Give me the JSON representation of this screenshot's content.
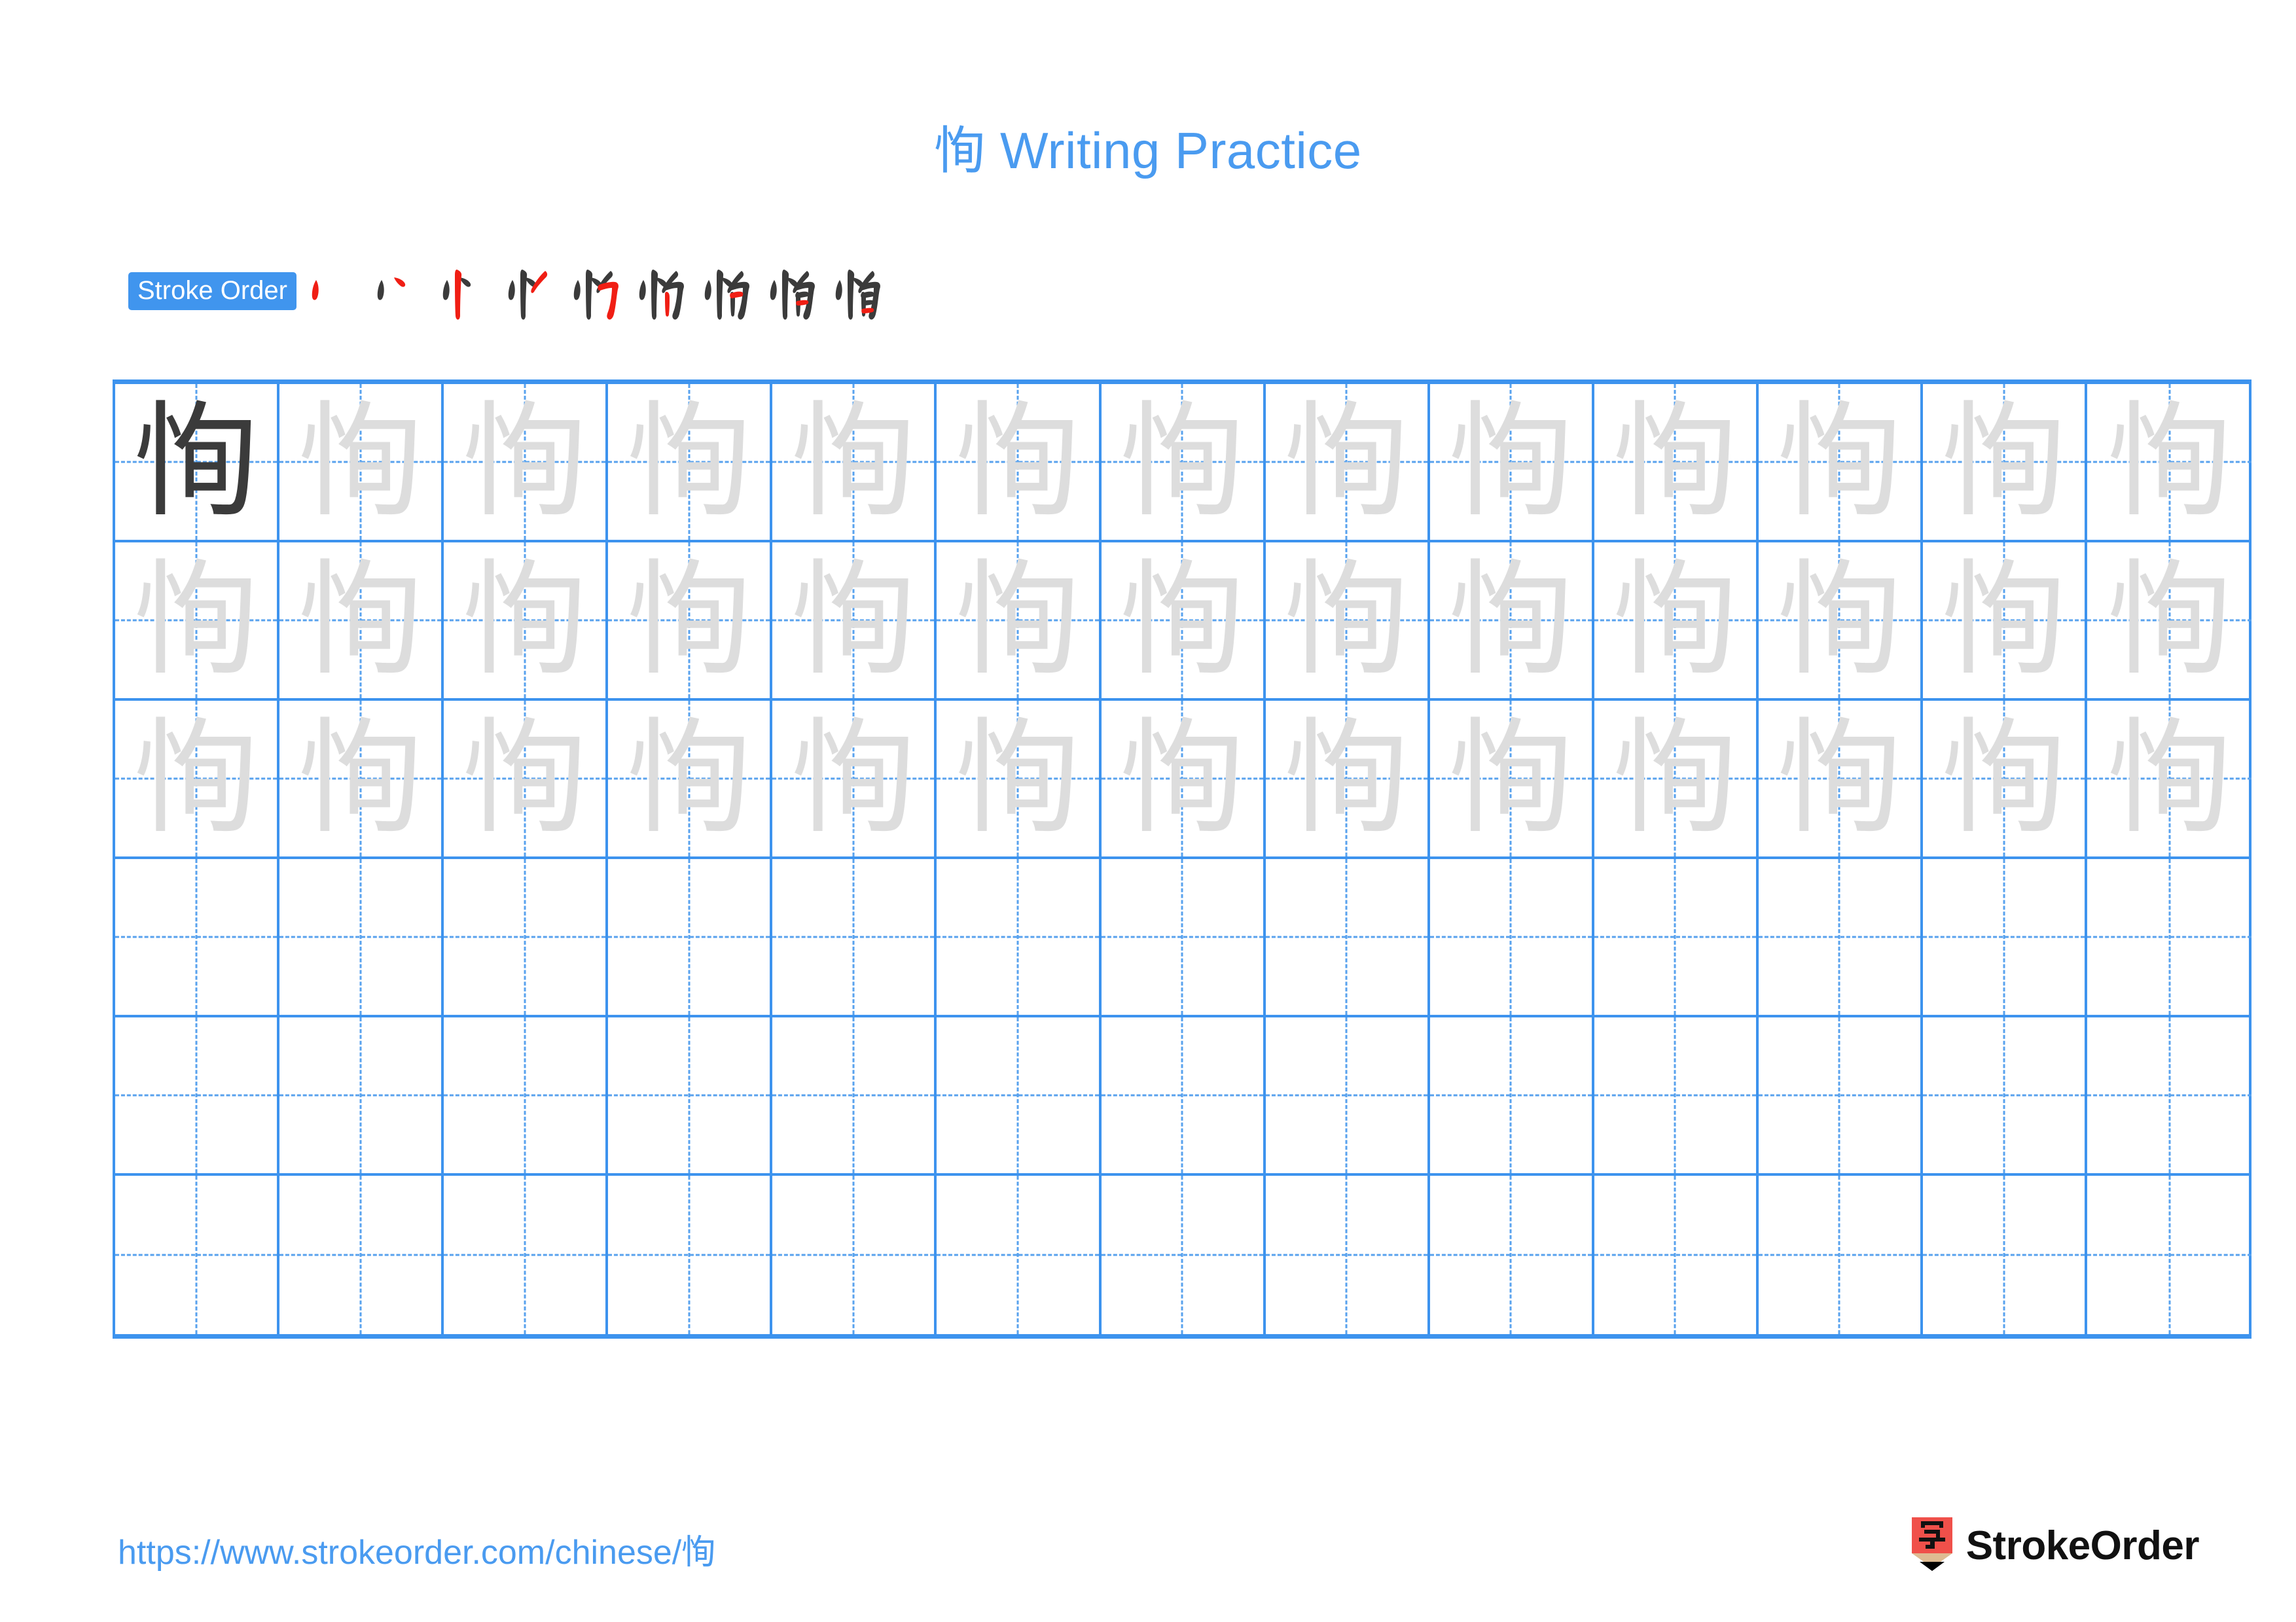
{
  "character": "恂",
  "header": {
    "title": "恂 Writing Practice"
  },
  "stroke_order": {
    "badge_label": "Stroke Order",
    "step_count": 9,
    "steps": [
      {
        "index": 1,
        "new_stroke": "dot-left",
        "glyph": "丶"
      },
      {
        "index": 2,
        "new_stroke": "dot-right",
        "glyph": "丷"
      },
      {
        "index": 3,
        "new_stroke": "vertical",
        "glyph": "忄"
      },
      {
        "index": 4,
        "new_stroke": "short-slant",
        "glyph": "忄丿"
      },
      {
        "index": 5,
        "new_stroke": "horizontal-fold-hook",
        "glyph": "忉"
      },
      {
        "index": 6,
        "new_stroke": "vertical-inner",
        "glyph": "忉丨"
      },
      {
        "index": 7,
        "new_stroke": "horizontal-fold",
        "glyph": "恂-7"
      },
      {
        "index": 8,
        "new_stroke": "horizontal-inner",
        "glyph": "恂-8"
      },
      {
        "index": 9,
        "new_stroke": "horizontal-bottom",
        "glyph": "恂"
      }
    ]
  },
  "grid": {
    "columns": 13,
    "rows": 6,
    "rows_data": [
      {
        "row": 1,
        "cells": [
          "恂",
          "恂",
          "恂",
          "恂",
          "恂",
          "恂",
          "恂",
          "恂",
          "恂",
          "恂",
          "恂",
          "恂",
          "恂"
        ],
        "styles": [
          "solid",
          "trace",
          "trace",
          "trace",
          "trace",
          "trace",
          "trace",
          "trace",
          "trace",
          "trace",
          "trace",
          "trace",
          "trace"
        ]
      },
      {
        "row": 2,
        "cells": [
          "恂",
          "恂",
          "恂",
          "恂",
          "恂",
          "恂",
          "恂",
          "恂",
          "恂",
          "恂",
          "恂",
          "恂",
          "恂"
        ],
        "styles": [
          "trace",
          "trace",
          "trace",
          "trace",
          "trace",
          "trace",
          "trace",
          "trace",
          "trace",
          "trace",
          "trace",
          "trace",
          "trace"
        ]
      },
      {
        "row": 3,
        "cells": [
          "恂",
          "恂",
          "恂",
          "恂",
          "恂",
          "恂",
          "恂",
          "恂",
          "恂",
          "恂",
          "恂",
          "恂",
          "恂"
        ],
        "styles": [
          "trace",
          "trace",
          "trace",
          "trace",
          "trace",
          "trace",
          "trace",
          "trace",
          "trace",
          "trace",
          "trace",
          "trace",
          "trace"
        ]
      },
      {
        "row": 4,
        "cells": [
          "",
          "",
          "",
          "",
          "",
          "",
          "",
          "",
          "",
          "",
          "",
          "",
          ""
        ],
        "styles": [
          "empty",
          "empty",
          "empty",
          "empty",
          "empty",
          "empty",
          "empty",
          "empty",
          "empty",
          "empty",
          "empty",
          "empty",
          "empty"
        ]
      },
      {
        "row": 5,
        "cells": [
          "",
          "",
          "",
          "",
          "",
          "",
          "",
          "",
          "",
          "",
          "",
          "",
          ""
        ],
        "styles": [
          "empty",
          "empty",
          "empty",
          "empty",
          "empty",
          "empty",
          "empty",
          "empty",
          "empty",
          "empty",
          "empty",
          "empty",
          "empty"
        ]
      },
      {
        "row": 6,
        "cells": [
          "",
          "",
          "",
          "",
          "",
          "",
          "",
          "",
          "",
          "",
          "",
          "",
          ""
        ],
        "styles": [
          "empty",
          "empty",
          "empty",
          "empty",
          "empty",
          "empty",
          "empty",
          "empty",
          "empty",
          "empty",
          "empty",
          "empty",
          "empty"
        ]
      }
    ]
  },
  "footer": {
    "url": "https://www.strokeorder.com/chinese/恂",
    "brand_name": "StrokeOrder",
    "logo_character": "字"
  },
  "colors": {
    "accent_blue": "#4a9bf0",
    "badge_blue": "#4095ee",
    "grid_blue": "#3d93ee",
    "grid_dash_blue": "#58a2ee",
    "trace_gray": "#dddddd",
    "ink_black": "#3b3b3b",
    "stroke_highlight_red": "#f01e14",
    "logo_red": "#f0504a",
    "logo_wood": "#debb92"
  }
}
